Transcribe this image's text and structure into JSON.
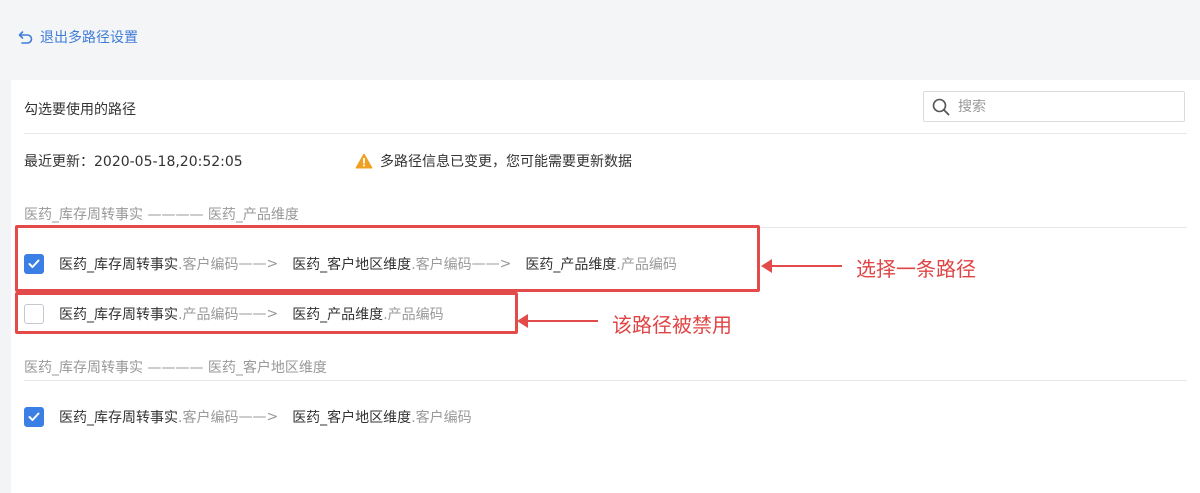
{
  "header": {
    "back_label": "退出多路径设置"
  },
  "panel": {
    "title": "勾选要使用的路径",
    "search_placeholder": "搜索",
    "updated_label": "最近更新：",
    "updated_time": "2020-05-18,20:52:05",
    "warning": "多路径信息已变更，您可能需要更新数据"
  },
  "groups": [
    {
      "title": "医药_库存周转事实 ———— 医药_产品维度",
      "paths": [
        {
          "checked": true,
          "segments": [
            {
              "table": "医药_库存周转事实",
              "field": ".客户编码",
              "arrow": "——>"
            },
            {
              "table": "医药_客户地区维度",
              "field": ".客户编码",
              "arrow": "——>"
            },
            {
              "table": "医药_产品维度",
              "field": ".产品编码"
            }
          ]
        },
        {
          "checked": false,
          "segments": [
            {
              "table": "医药_库存周转事实",
              "field": ".产品编码",
              "arrow": "——>"
            },
            {
              "table": "医药_产品维度",
              "field": ".产品编码"
            }
          ]
        }
      ]
    },
    {
      "title": "医药_库存周转事实 ———— 医药_客户地区维度",
      "paths": [
        {
          "checked": true,
          "segments": [
            {
              "table": "医药_库存周转事实",
              "field": ".客户编码",
              "arrow": "——>"
            },
            {
              "table": "医药_客户地区维度",
              "field": ".客户编码"
            }
          ]
        }
      ]
    }
  ],
  "annotations": {
    "select_path": "选择一条路径",
    "path_disabled": "该路径被禁用"
  },
  "colors": {
    "accent": "#3a7ee6",
    "annotation": "#e34b4b",
    "warning": "#f0a020"
  }
}
